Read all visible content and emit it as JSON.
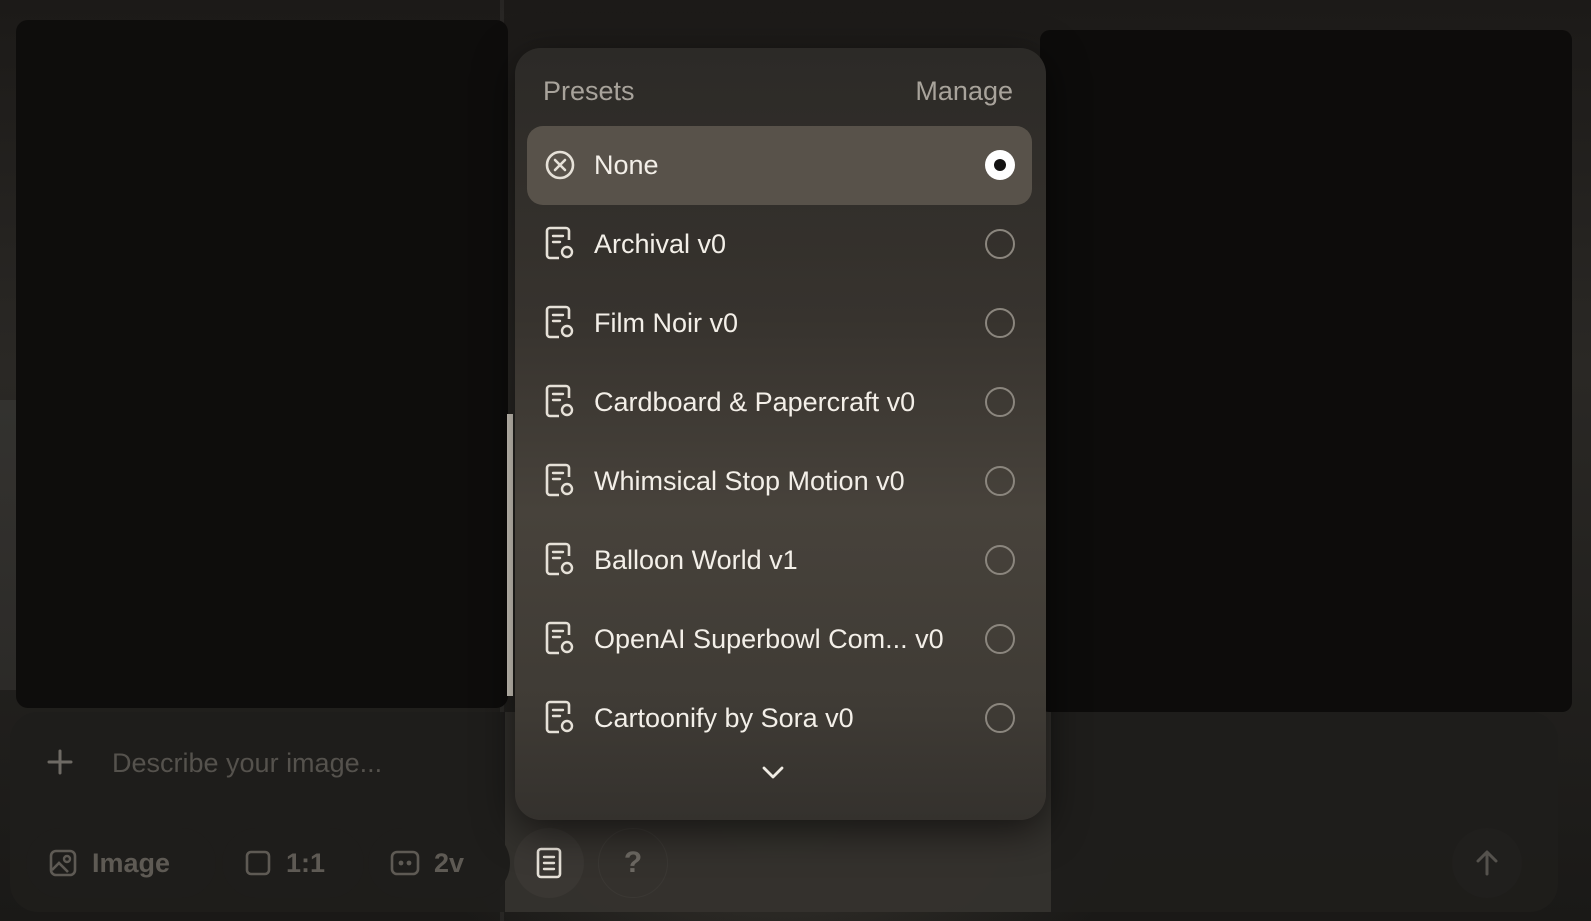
{
  "composer": {
    "placeholder": "Describe your image...",
    "buttons": {
      "type_label": "Image",
      "aspect_label": "1:1",
      "variations_label": "2v",
      "help_label": "?"
    }
  },
  "presets_menu": {
    "title": "Presets",
    "manage_label": "Manage",
    "selected": "None",
    "items": [
      {
        "label": "None",
        "icon": "x-circle-icon",
        "selected": true
      },
      {
        "label": "Archival v0",
        "icon": "preset-icon",
        "selected": false
      },
      {
        "label": "Film Noir v0",
        "icon": "preset-icon",
        "selected": false
      },
      {
        "label": "Cardboard & Papercraft v0",
        "icon": "preset-icon",
        "selected": false
      },
      {
        "label": "Whimsical Stop Motion v0",
        "icon": "preset-icon",
        "selected": false
      },
      {
        "label": "Balloon World v1",
        "icon": "preset-icon",
        "selected": false
      },
      {
        "label": "OpenAI Superbowl Com... v0",
        "icon": "preset-icon",
        "selected": false
      },
      {
        "label": "Cartoonify by Sora v0",
        "icon": "preset-icon",
        "selected": false
      }
    ],
    "more_icon": "chevron-down-icon"
  },
  "colors": {
    "menu_background": "#3a3631",
    "selected_row": "#58524a",
    "text": "#f3efe8",
    "muted_text": "#a8a39b"
  }
}
